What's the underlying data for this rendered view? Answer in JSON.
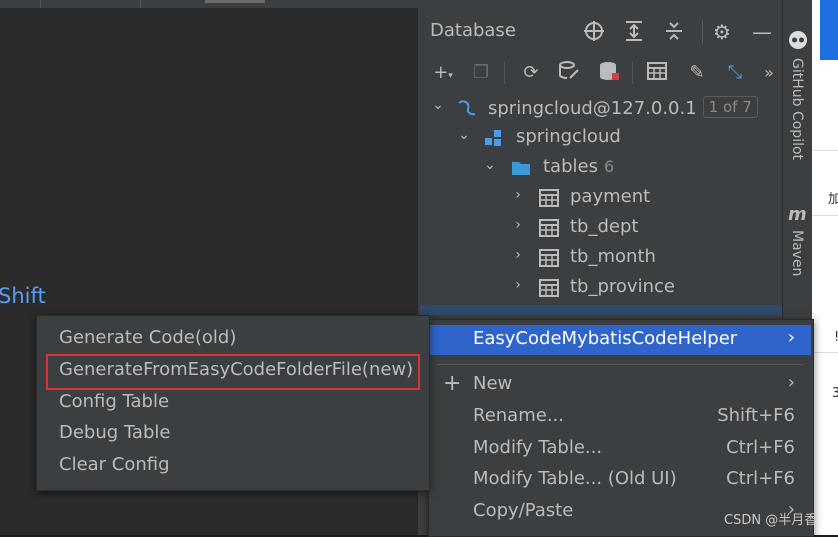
{
  "editor": {
    "shift_text": "Shift"
  },
  "database_panel": {
    "title": "Database",
    "header_icons": [
      "crosshair-icon",
      "expand-all-icon",
      "collapse-all-icon",
      "gear-icon",
      "minimize-icon"
    ],
    "toolbar_icons": [
      "add-icon",
      "copy-icon",
      "refresh-icon",
      "data-source-properties-icon",
      "database-icon",
      "table-icon",
      "edit-icon",
      "jump-icon",
      "more-icon"
    ],
    "tree": {
      "connection": {
        "label": "springcloud@127.0.0.1",
        "badge": "1 of 7"
      },
      "schema": {
        "label": "springcloud"
      },
      "tables_folder": {
        "label": "tables",
        "count": "6"
      },
      "tables": [
        "payment",
        "tb_dept",
        "tb_month",
        "tb_province"
      ]
    }
  },
  "right_strip": {
    "copilot_label": "GitHub Copilot",
    "maven_label": "Maven"
  },
  "context_menu": {
    "items": [
      {
        "label": "EasyCodeMybatisCodeHelper",
        "shortcut": "",
        "submenu": true
      },
      {
        "label": "New",
        "shortcut": "",
        "submenu": true
      },
      {
        "label": "Rename...",
        "shortcut": "Shift+F6",
        "submenu": false
      },
      {
        "label": "Modify Table...",
        "shortcut": "Ctrl+F6",
        "submenu": false
      },
      {
        "label": "Modify Table... (Old UI)",
        "shortcut": "Ctrl+F6",
        "submenu": false
      },
      {
        "label": "Copy/Paste",
        "shortcut": "",
        "submenu": true
      }
    ]
  },
  "submenu": {
    "items": [
      "Generate Code(old)",
      "GenerateFromEasyCodeFolderFile(new)",
      "Config Table",
      "Debug Table",
      "Clear Config"
    ]
  },
  "outer_right": {
    "glyph1": "加",
    "glyph2": "!",
    "glyph3": "3"
  },
  "watermark": "CSDN @半月香",
  "colors": {
    "highlight": "#2f65ca",
    "red_box": "#e03030",
    "link_blue": "#589df6"
  }
}
